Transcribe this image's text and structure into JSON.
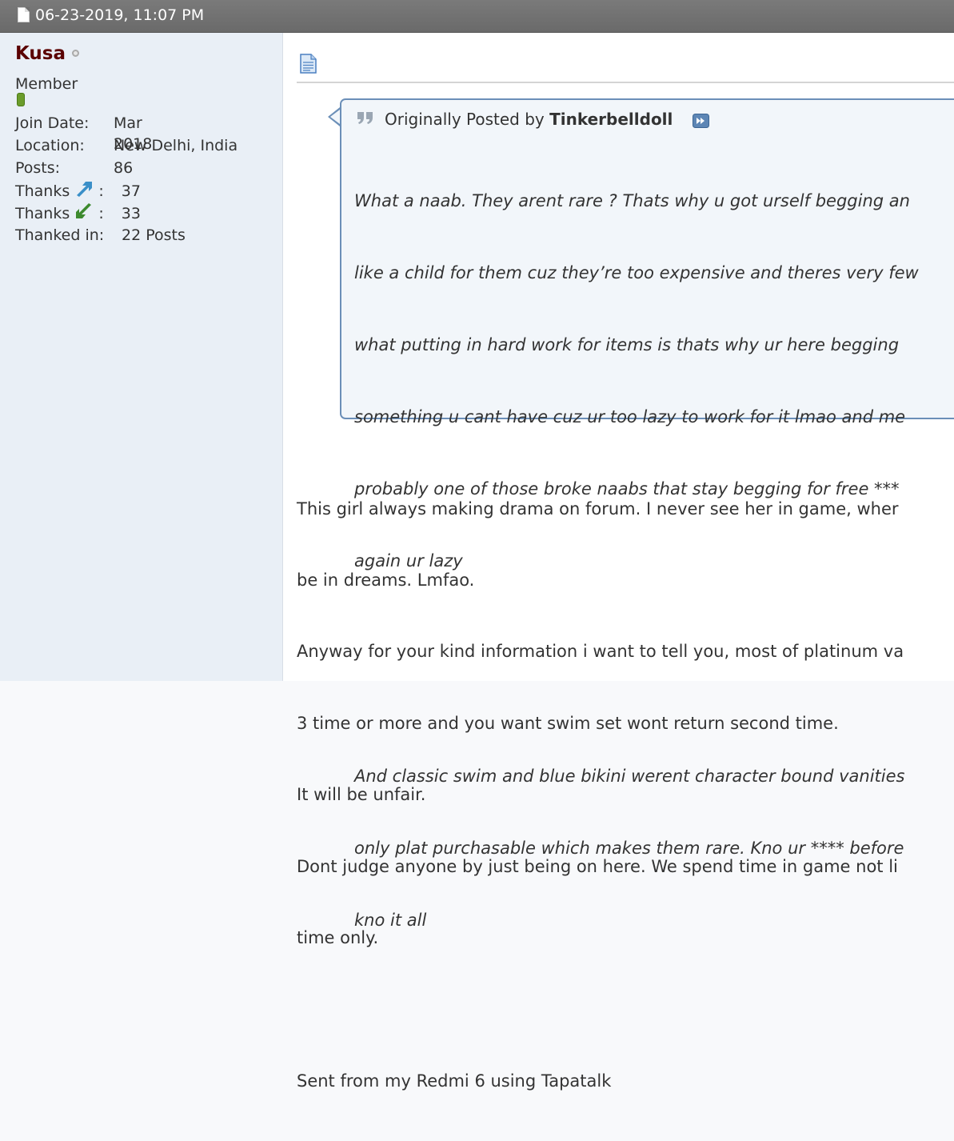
{
  "post": {
    "date": "06-23-2019, 11:07 PM"
  },
  "user": {
    "name": "Kusa",
    "title": "Member",
    "join_date_label": "Join Date:",
    "join_date": "Mar 2018",
    "location_label": "Location:",
    "location": "New Delhi, India",
    "posts_label": "Posts:",
    "posts": "86",
    "thanks_given_label": "Thanks",
    "thanks_given": "37",
    "thanks_received_label": "Thanks",
    "thanks_received": "33",
    "thanked_in_label": "Thanked in:",
    "thanked_in": "22 Posts",
    "colon": ":"
  },
  "quote": {
    "prefix": "Originally Posted by",
    "author": "Tinkerbelldoll",
    "lines": [
      "What a naab. They arent rare ? Thats why u got urself begging an",
      "like a child for them cuz they’re too expensive and theres very few",
      "what putting in hard work for items is thats why ur here begging",
      "something u cant have cuz ur too lazy to work for it lmao and me",
      "probably one of those broke naabs that stay begging for free ***",
      "again ur lazy",
      "",
      "",
      "And classic swim and blue bikini werent character bound vanities",
      "only plat purchasable which makes them rare. Kno ur **** before",
      "kno it all"
    ]
  },
  "message": {
    "lines": [
      "This girl always making drama on forum. I never see her in game, wher",
      "be in dreams. Lmfao.",
      "Anyway for your kind information i want to tell you, most of platinum va",
      "3 time or more and you want swim set wont return second time.",
      "It will be unfair.",
      "Dont judge anyone by just being on here. We spend time in game not li",
      "time only.",
      "",
      "Sent from my Redmi 6 using Tapatalk"
    ]
  },
  "colors": {
    "username": "#5a0000",
    "header_bg": "#6f6f6f",
    "sidebar_bg": "#e9eff6",
    "quote_border": "#6b8fb8",
    "thanks_up": "#3a8fc8",
    "thanks_down": "#3d8a2e"
  },
  "icons": {
    "post_icon": "document-icon",
    "quote_icon": "quote-marks-icon",
    "view_post": "view-post-icon",
    "status": "offline-status-icon"
  }
}
